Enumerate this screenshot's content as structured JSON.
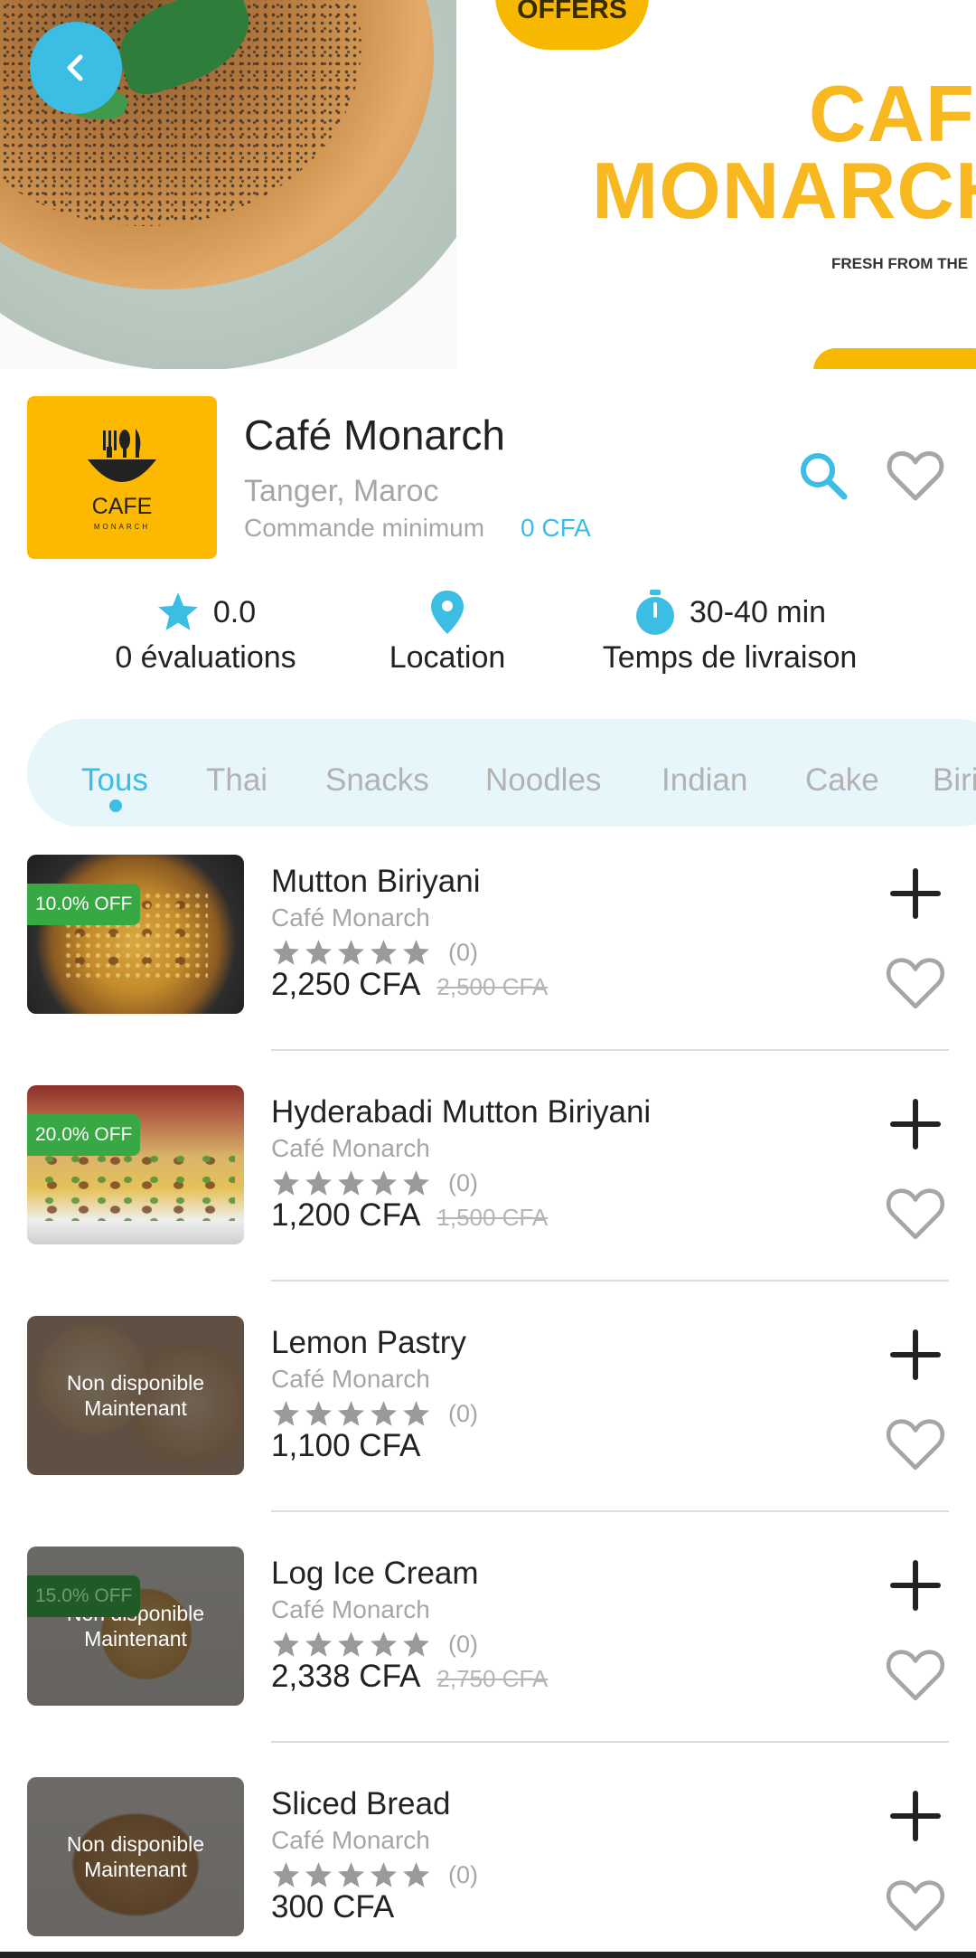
{
  "banner": {
    "offers_badge": "OFFERS",
    "brand_line1": "CAFE",
    "brand_line2": "MONARCH",
    "tagline": "FRESH FROM THE"
  },
  "restaurant": {
    "logo_text": "CAFE",
    "logo_subtext": "MONARCH",
    "name": "Café Monarch",
    "location": "Tanger, Maroc",
    "min_order_label": "Commande minimum",
    "min_order_value": "0 CFA"
  },
  "stats": {
    "rating_value": "0.0",
    "rating_label": "0 évaluations",
    "location_label": "Location",
    "delivery_time": "30-40 min",
    "delivery_label": "Temps de livraison"
  },
  "categories": [
    "Tous",
    "Thai",
    "Snacks",
    "Noodles",
    "Indian",
    "Cake",
    "Biri"
  ],
  "active_category": "Tous",
  "items": [
    {
      "name": "Mutton Biriyani",
      "cafe": "Café Monarch",
      "rating_count": "(0)",
      "price": "2,250 CFA",
      "old_price": "2,500 CFA",
      "discount": "10.0% OFF",
      "unavailable": ""
    },
    {
      "name": "Hyderabadi Mutton Biriyani",
      "cafe": "Café Monarch",
      "rating_count": "(0)",
      "price": "1,200 CFA",
      "old_price": "1,500 CFA",
      "discount": "20.0% OFF",
      "unavailable": ""
    },
    {
      "name": "Lemon Pastry",
      "cafe": "Café Monarch",
      "rating_count": "(0)",
      "price": "1,100 CFA",
      "old_price": "",
      "discount": "",
      "unavailable_line1": "Non disponible",
      "unavailable_line2": "Maintenant"
    },
    {
      "name": "Log Ice Cream",
      "cafe": "Café Monarch",
      "rating_count": "(0)",
      "price": "2,338 CFA",
      "old_price": "2,750 CFA",
      "discount": "15.0% OFF",
      "unavailable_line1": "Non disponible",
      "unavailable_line2": "Maintenant"
    },
    {
      "name": "Sliced Bread",
      "cafe": "Café Monarch",
      "rating_count": "(0)",
      "price": "300 CFA",
      "old_price": "",
      "discount": "",
      "unavailable_line1": "Non disponible",
      "unavailable_line2": "Maintenant"
    }
  ],
  "colors": {
    "accent": "#3bbde4",
    "discount_green": "#38a845",
    "logo_yellow": "#fcb900",
    "muted_text": "#a6a6a6"
  },
  "icons": [
    "back-arrow-icon",
    "search-icon",
    "heart-icon",
    "star-icon",
    "location-pin-icon",
    "timer-icon",
    "plus-icon"
  ]
}
